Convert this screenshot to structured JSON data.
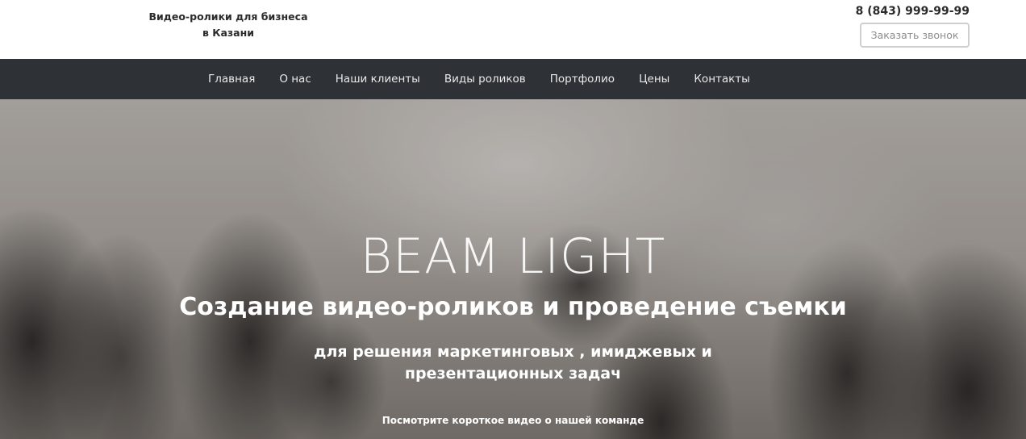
{
  "header": {
    "tagline_line1": "Видео-ролики для бизнеса",
    "tagline_line2": "в Казани",
    "phone": "8 (843) 999-99-99",
    "callback_button": "Заказать звонок"
  },
  "nav": {
    "items": [
      {
        "label": "Главная"
      },
      {
        "label": "О нас"
      },
      {
        "label": "Наши клиенты"
      },
      {
        "label": "Виды роликов"
      },
      {
        "label": "Портфолио"
      },
      {
        "label": "Цены"
      },
      {
        "label": "Контакты"
      }
    ]
  },
  "hero": {
    "brand": "BEAM LIGHT",
    "headline": "Создание видео-роликов и проведение съемки",
    "subheadline_line1": "для решения маркетинговых , имиджевых и",
    "subheadline_line2": "презентационных задач",
    "video_link": "Посмотрите короткое видео о нашей команде"
  },
  "colors": {
    "nav_background": "#2e3236",
    "text_dark": "#2b2b2b",
    "button_border": "#cfcfcf"
  }
}
